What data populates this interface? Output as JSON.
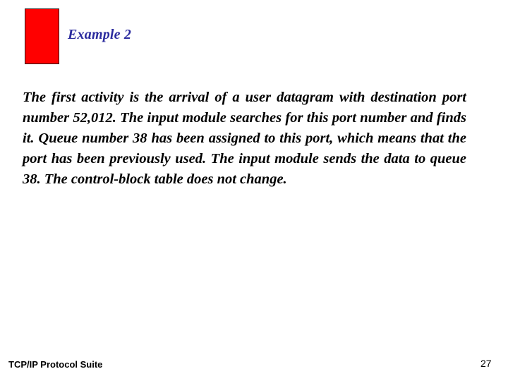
{
  "slide": {
    "title": "Example 2",
    "title_color": "#2B2B9E",
    "background_color": "#FFFFFF"
  },
  "decoration": {
    "red_block_color": "#FF0000",
    "red_block_border_color": "#231F20",
    "name": "red-accent-block"
  },
  "body": {
    "paragraph": "The first activity is the arrival of a user datagram with destination port number 52,012. The input module searches for this port number and finds it. Queue number 38 has been assigned to this port, which means that the port has been previously used. The input module sends the data to queue 38. The control-block table does not change.",
    "lines": [
      "The first activity is the arrival of a user datagram with",
      "destination port number 52,012. The input module searches for",
      "this port number and finds it. Queue number 38 has been",
      "assigned to this port, which means that the port has been",
      "previously used. The input module sends the data to queue 38.",
      "The control-block table does not change."
    ],
    "text_color": "#000000"
  },
  "footer": {
    "title": "TCP/IP Protocol Suite",
    "page_number": "27"
  }
}
